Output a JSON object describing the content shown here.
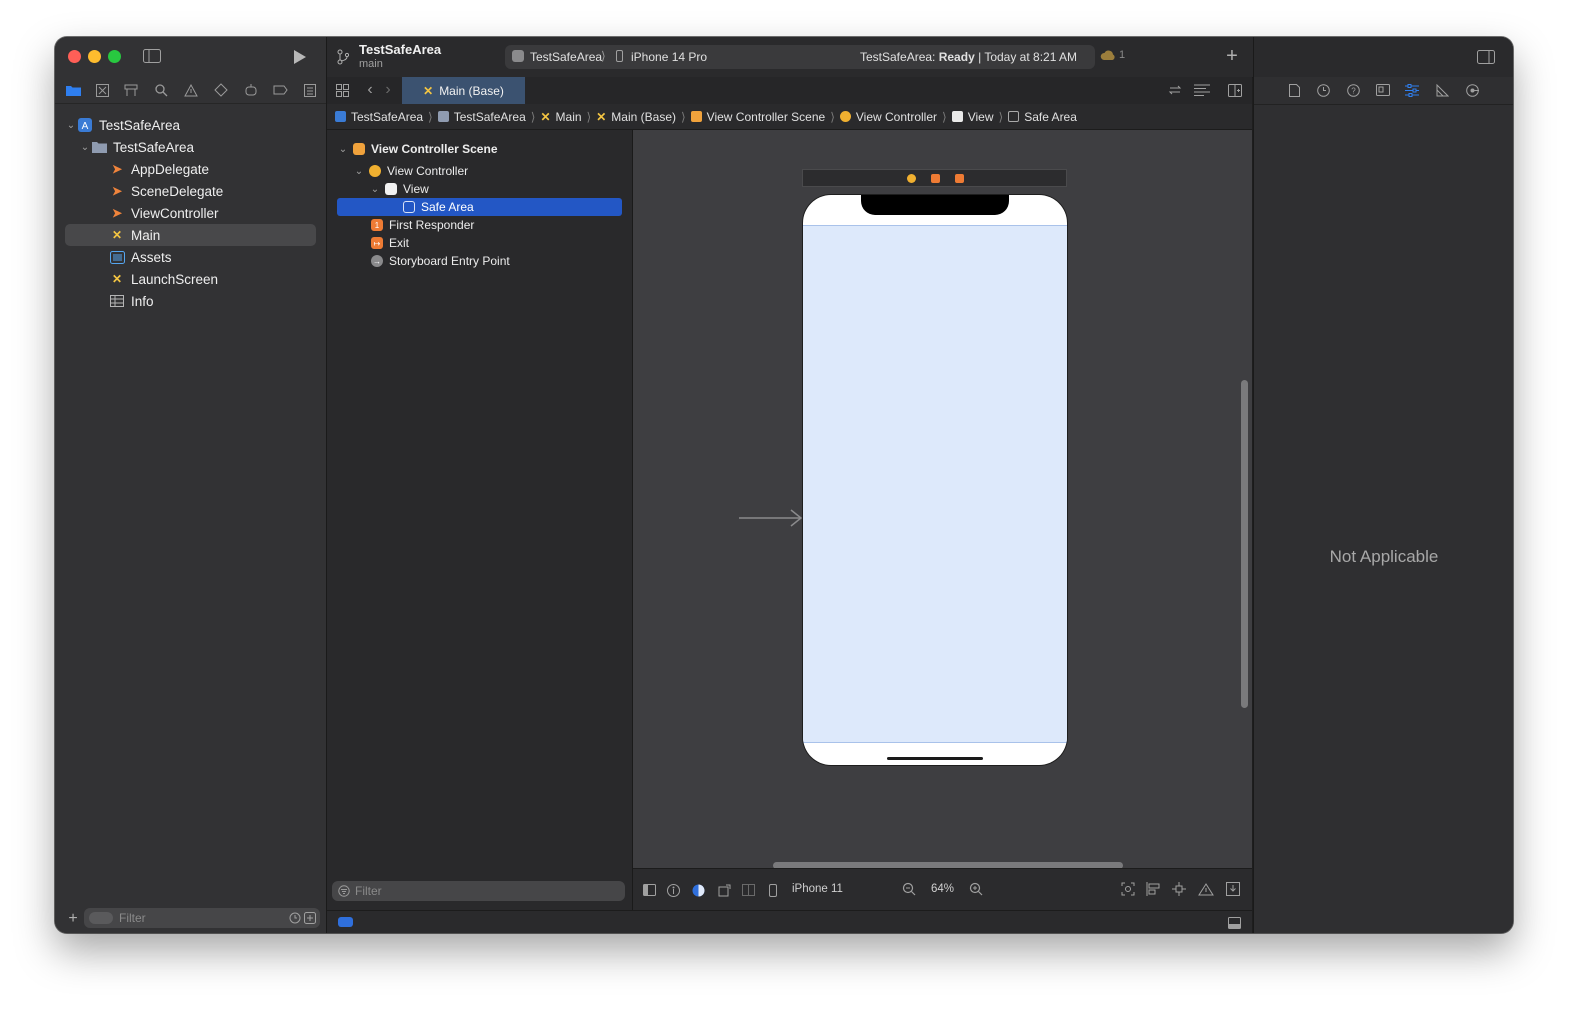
{
  "toolbar": {
    "project_title": "TestSafeArea",
    "branch": "main",
    "scheme": "TestSafeArea",
    "destination": "iPhone 14 Pro",
    "status_project": "TestSafeArea:",
    "status_state": "Ready",
    "status_time": "| Today at 8:21 AM",
    "warnings_count": "1"
  },
  "navigator": {
    "items": [
      {
        "label": "TestSafeArea",
        "icon": "project-icon"
      },
      {
        "label": "TestSafeArea",
        "icon": "folder-icon"
      },
      {
        "label": "AppDelegate",
        "icon": "swift-file-icon"
      },
      {
        "label": "SceneDelegate",
        "icon": "swift-file-icon"
      },
      {
        "label": "ViewController",
        "icon": "swift-file-icon"
      },
      {
        "label": "Main",
        "icon": "storyboard-icon"
      },
      {
        "label": "Assets",
        "icon": "assets-icon"
      },
      {
        "label": "LaunchScreen",
        "icon": "storyboard-icon"
      },
      {
        "label": "Info",
        "icon": "plist-icon"
      }
    ],
    "filter_placeholder": "Filter"
  },
  "editor": {
    "tab_label": "Main (Base)",
    "breadcrumb": [
      "TestSafeArea",
      "TestSafeArea",
      "Main",
      "Main (Base)",
      "View Controller Scene",
      "View Controller",
      "View",
      "Safe Area"
    ]
  },
  "outline": {
    "items": [
      {
        "label": "View Controller Scene"
      },
      {
        "label": "View Controller"
      },
      {
        "label": "View"
      },
      {
        "label": "Safe Area"
      },
      {
        "label": "First Responder"
      },
      {
        "label": "Exit"
      },
      {
        "label": "Storyboard Entry Point"
      }
    ],
    "filter_placeholder": "Filter"
  },
  "canvas": {
    "device": "iPhone 11",
    "zoom": "64%"
  },
  "inspector": {
    "message": "Not Applicable"
  },
  "colors": {
    "accent": "#2f6fdc",
    "selection": "#2357c5",
    "safe_area": "#dde9fb"
  }
}
